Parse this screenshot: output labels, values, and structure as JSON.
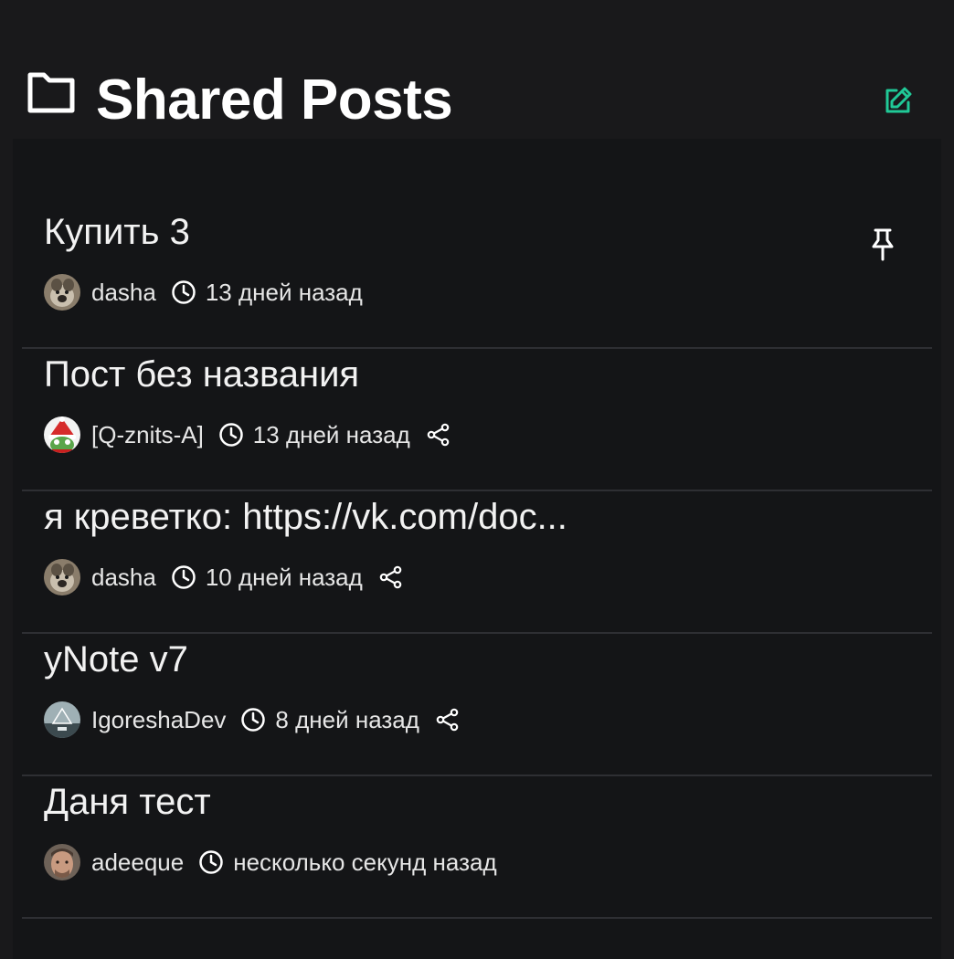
{
  "header": {
    "title": "Shared Posts",
    "folder_icon": "folder-icon",
    "edit_icon": "edit-icon"
  },
  "colors": {
    "accent": "#20c997",
    "background": "#19191b",
    "list_background": "#141517",
    "divider": "#2e2f33"
  },
  "posts": [
    {
      "title": "Купить 3",
      "author": "dasha",
      "time": "13 дней назад",
      "pinned": true,
      "shared": false
    },
    {
      "title": "Пост без названия",
      "author": "[Q-znits-A]",
      "time": "13 дней назад",
      "pinned": false,
      "shared": true
    },
    {
      "title": "я креветко: https://vk.com/doc...",
      "author": "dasha",
      "time": "10 дней назад",
      "pinned": false,
      "shared": true
    },
    {
      "title": "yNote v7",
      "author": "IgoreshaDev",
      "time": "8 дней назад",
      "pinned": false,
      "shared": true
    },
    {
      "title": "Даня тест",
      "author": "adeeque",
      "time": "несколько секунд назад",
      "pinned": false,
      "shared": false
    }
  ]
}
